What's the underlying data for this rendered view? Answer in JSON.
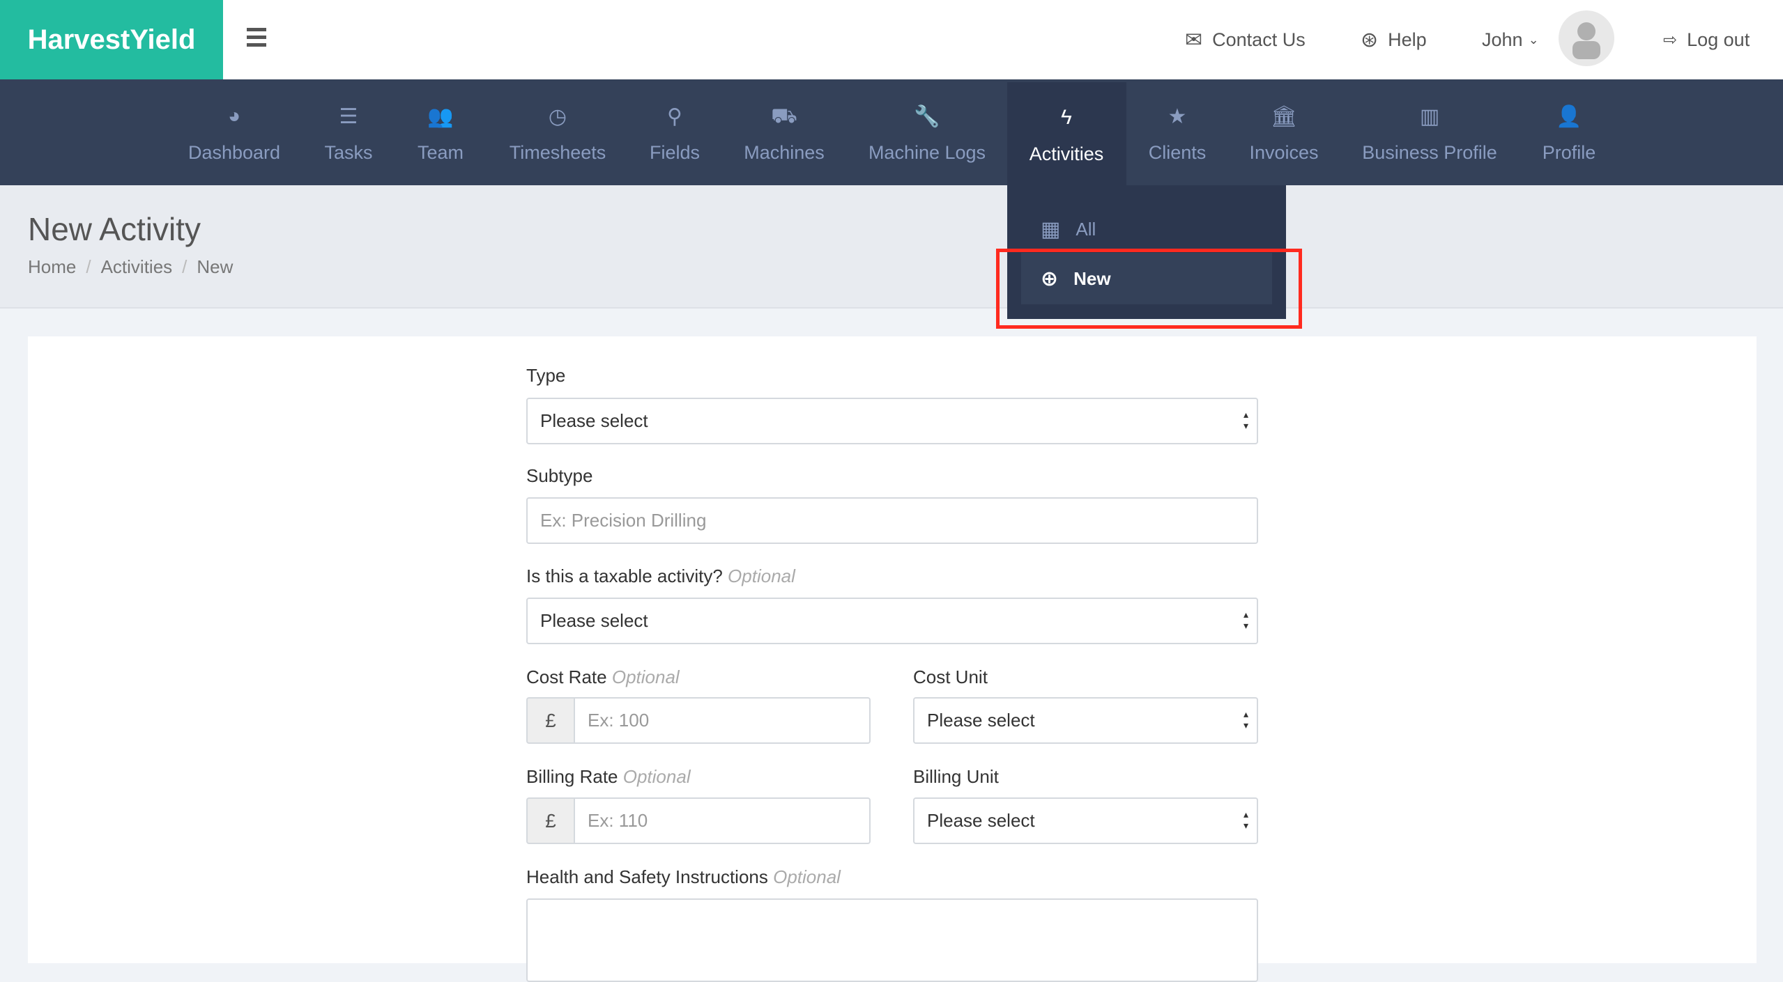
{
  "app": {
    "brand": "HarvestYield"
  },
  "topbar": {
    "contact": "Contact Us",
    "help": "Help",
    "user": "John",
    "logout": "Log out"
  },
  "nav": [
    {
      "label": "Dashboard",
      "icon": "dashboard-icon",
      "glyph": "◕"
    },
    {
      "label": "Tasks",
      "icon": "list-icon",
      "glyph": "☰"
    },
    {
      "label": "Team",
      "icon": "users-icon",
      "glyph": "👥"
    },
    {
      "label": "Timesheets",
      "icon": "clock-icon",
      "glyph": "◷"
    },
    {
      "label": "Fields",
      "icon": "map-marker-icon",
      "glyph": "⚲"
    },
    {
      "label": "Machines",
      "icon": "truck-icon",
      "glyph": "⛟"
    },
    {
      "label": "Machine Logs",
      "icon": "wrench-icon",
      "glyph": "🔧"
    },
    {
      "label": "Activities",
      "icon": "bolt-icon",
      "glyph": "ϟ"
    },
    {
      "label": "Clients",
      "icon": "star-icon",
      "glyph": "★"
    },
    {
      "label": "Invoices",
      "icon": "bank-icon",
      "glyph": "🏛"
    },
    {
      "label": "Business Profile",
      "icon": "building-icon",
      "glyph": "▥"
    },
    {
      "label": "Profile",
      "icon": "user-icon",
      "glyph": "👤"
    }
  ],
  "dropdown": {
    "all": "All",
    "new": "New"
  },
  "page": {
    "title": "New Activity",
    "breadcrumb": [
      "Home",
      "Activities",
      "New"
    ]
  },
  "form": {
    "type_label": "Type",
    "type_value": "Please select",
    "subtype_label": "Subtype",
    "subtype_placeholder": "Ex: Precision Drilling",
    "taxable_label": "Is this a taxable activity?",
    "optional": "Optional",
    "taxable_value": "Please select",
    "cost_rate_label": "Cost Rate",
    "cost_rate_placeholder": "Ex: 100",
    "currency": "£",
    "cost_unit_label": "Cost Unit",
    "cost_unit_value": "Please select",
    "billing_rate_label": "Billing Rate",
    "billing_rate_placeholder": "Ex: 110",
    "billing_unit_label": "Billing Unit",
    "billing_unit_value": "Please select",
    "hs_label": "Health and Safety Instructions"
  },
  "colors": {
    "brand": "#23bca0",
    "nav": "#344159",
    "highlight": "#ff2a1f"
  }
}
